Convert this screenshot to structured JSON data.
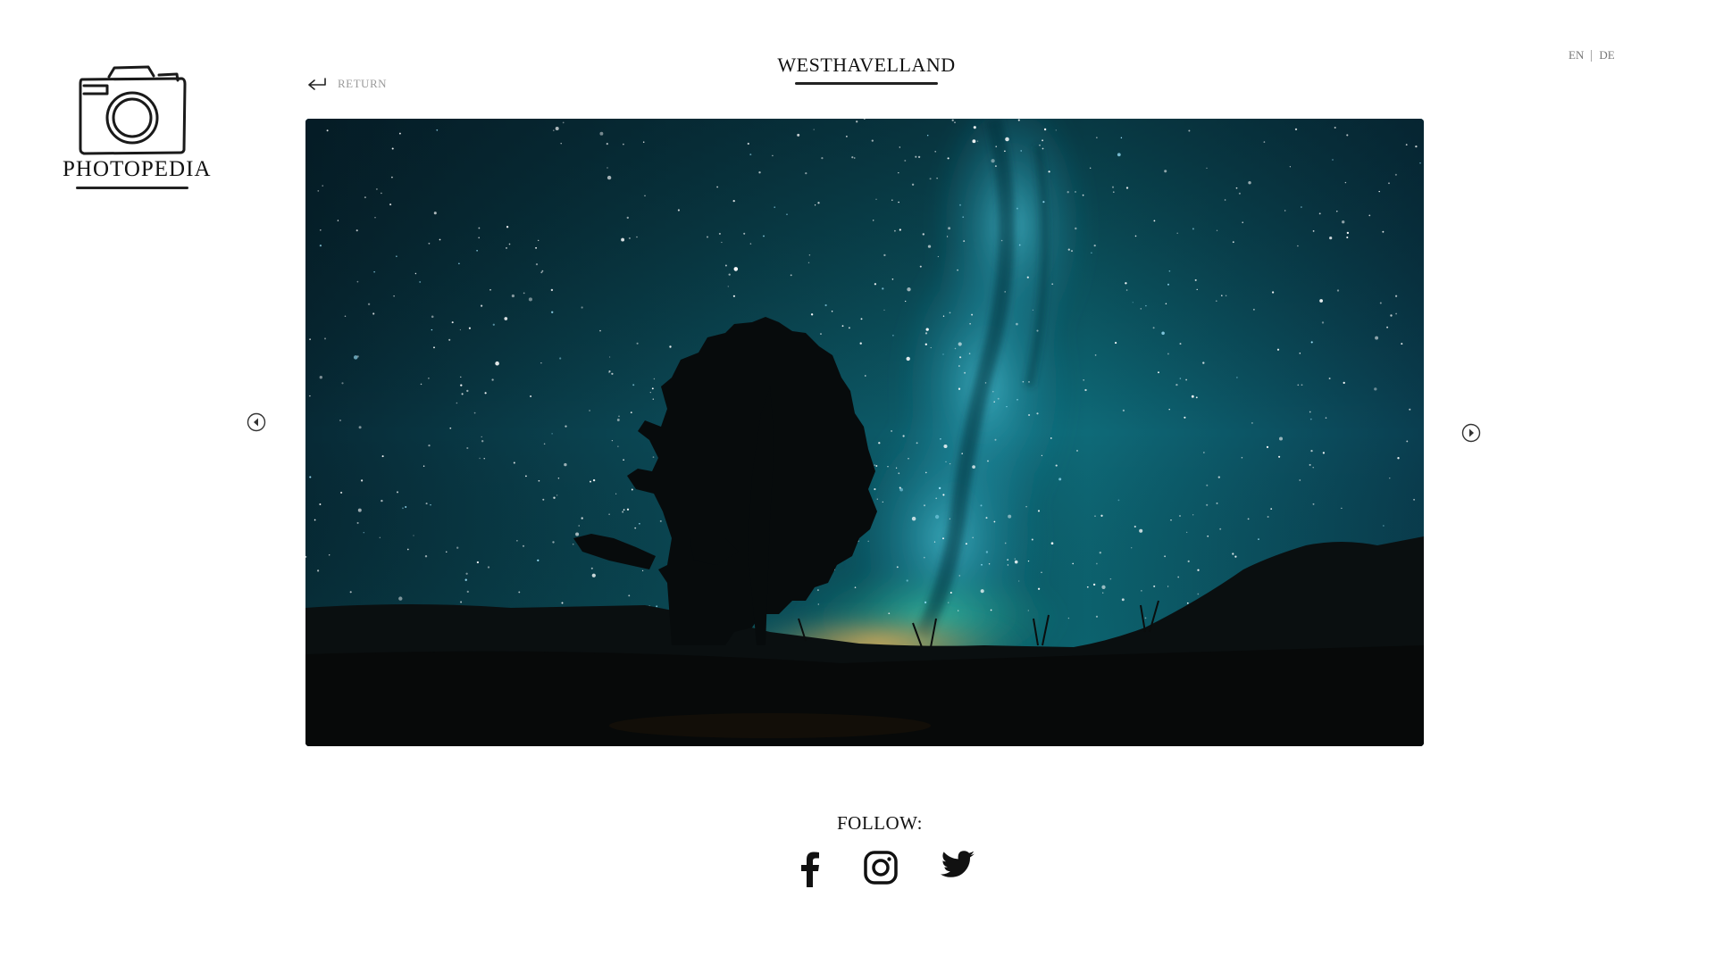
{
  "brand": {
    "name": "PHOTOPEDIA",
    "logo_icon": "camera-icon"
  },
  "header": {
    "title": "WESTHAVELLAND",
    "return_label": "RETURN"
  },
  "language": {
    "options": [
      "EN",
      "DE"
    ],
    "selected": "EN"
  },
  "gallery": {
    "photo_subject": "night sky with milky way and tree silhouette",
    "prev_icon": "arrow-left-circle-icon",
    "next_icon": "arrow-right-circle-icon"
  },
  "footer": {
    "follow_label": "FOLLOW:",
    "social": [
      {
        "icon": "facebook-icon"
      },
      {
        "icon": "instagram-icon"
      },
      {
        "icon": "twitter-icon"
      }
    ]
  },
  "colors": {
    "text": "#111111",
    "muted": "#999999",
    "sky_dark": "#071a22",
    "sky_mid": "#0e5866",
    "milky_way": "#2aa6b8",
    "horizon_glow": "#d6a450"
  }
}
